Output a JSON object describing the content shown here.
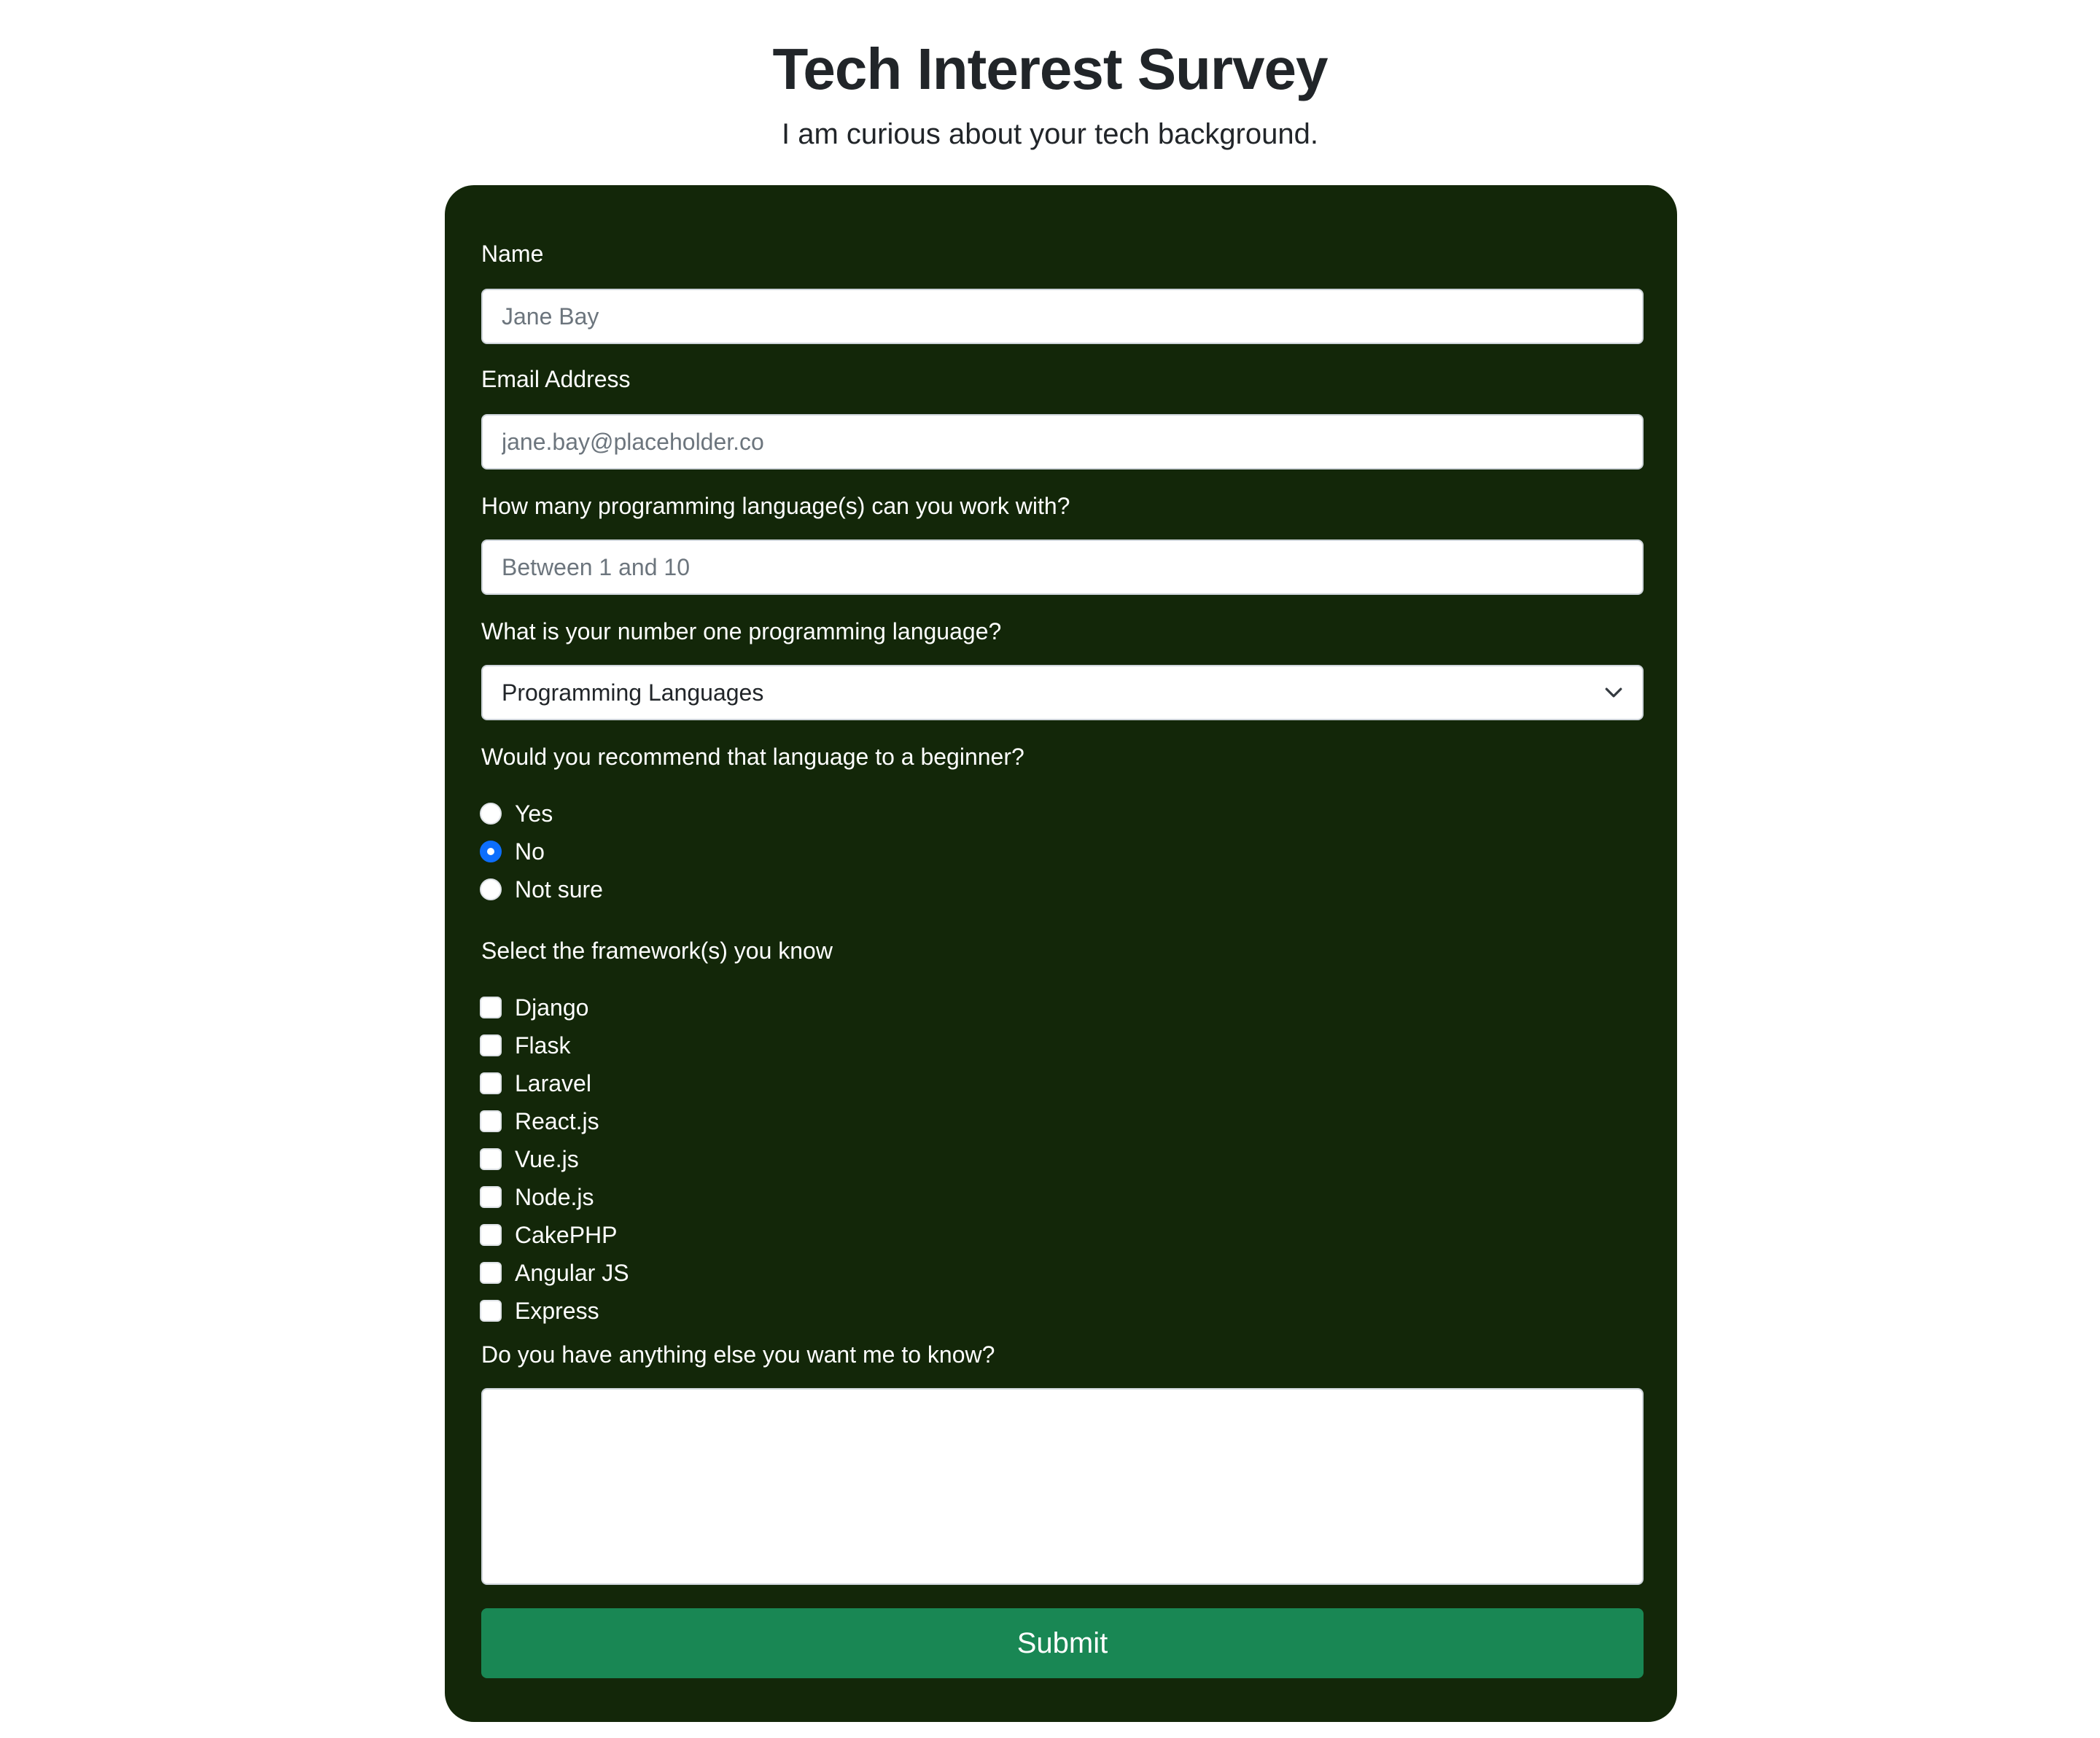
{
  "header": {
    "title": "Tech Interest Survey",
    "subtitle": "I am curious about your tech background."
  },
  "form": {
    "name": {
      "label": "Name",
      "placeholder": "Jane Bay"
    },
    "email": {
      "label": "Email Address",
      "placeholder": "jane.bay@placeholder.co"
    },
    "count": {
      "label": "How many programming language(s) can you work with?",
      "placeholder": "Between 1 and 10"
    },
    "favorite": {
      "label": "What is your number one programming language?",
      "selected": "Programming Languages"
    },
    "recommend": {
      "label": "Would you recommend that language to a beginner?",
      "options": [
        {
          "label": "Yes",
          "checked": false
        },
        {
          "label": "No",
          "checked": true
        },
        {
          "label": "Not sure",
          "checked": false
        }
      ]
    },
    "frameworks": {
      "label": "Select the framework(s) you know",
      "options": [
        {
          "label": "Django",
          "checked": false
        },
        {
          "label": "Flask",
          "checked": false
        },
        {
          "label": "Laravel",
          "checked": false
        },
        {
          "label": "React.js",
          "checked": false
        },
        {
          "label": "Vue.js",
          "checked": false
        },
        {
          "label": "Node.js",
          "checked": false
        },
        {
          "label": "CakePHP",
          "checked": false
        },
        {
          "label": "Angular JS",
          "checked": false
        },
        {
          "label": "Express",
          "checked": false
        }
      ]
    },
    "comments": {
      "label": "Do you have anything else you want me to know?",
      "value": ""
    },
    "submit_label": "Submit"
  },
  "colors": {
    "card_background": "#132709",
    "submit_background": "#198754",
    "radio_checked": "#0d6efd"
  },
  "icons": {
    "select_chevron": "chevron-down-icon"
  }
}
